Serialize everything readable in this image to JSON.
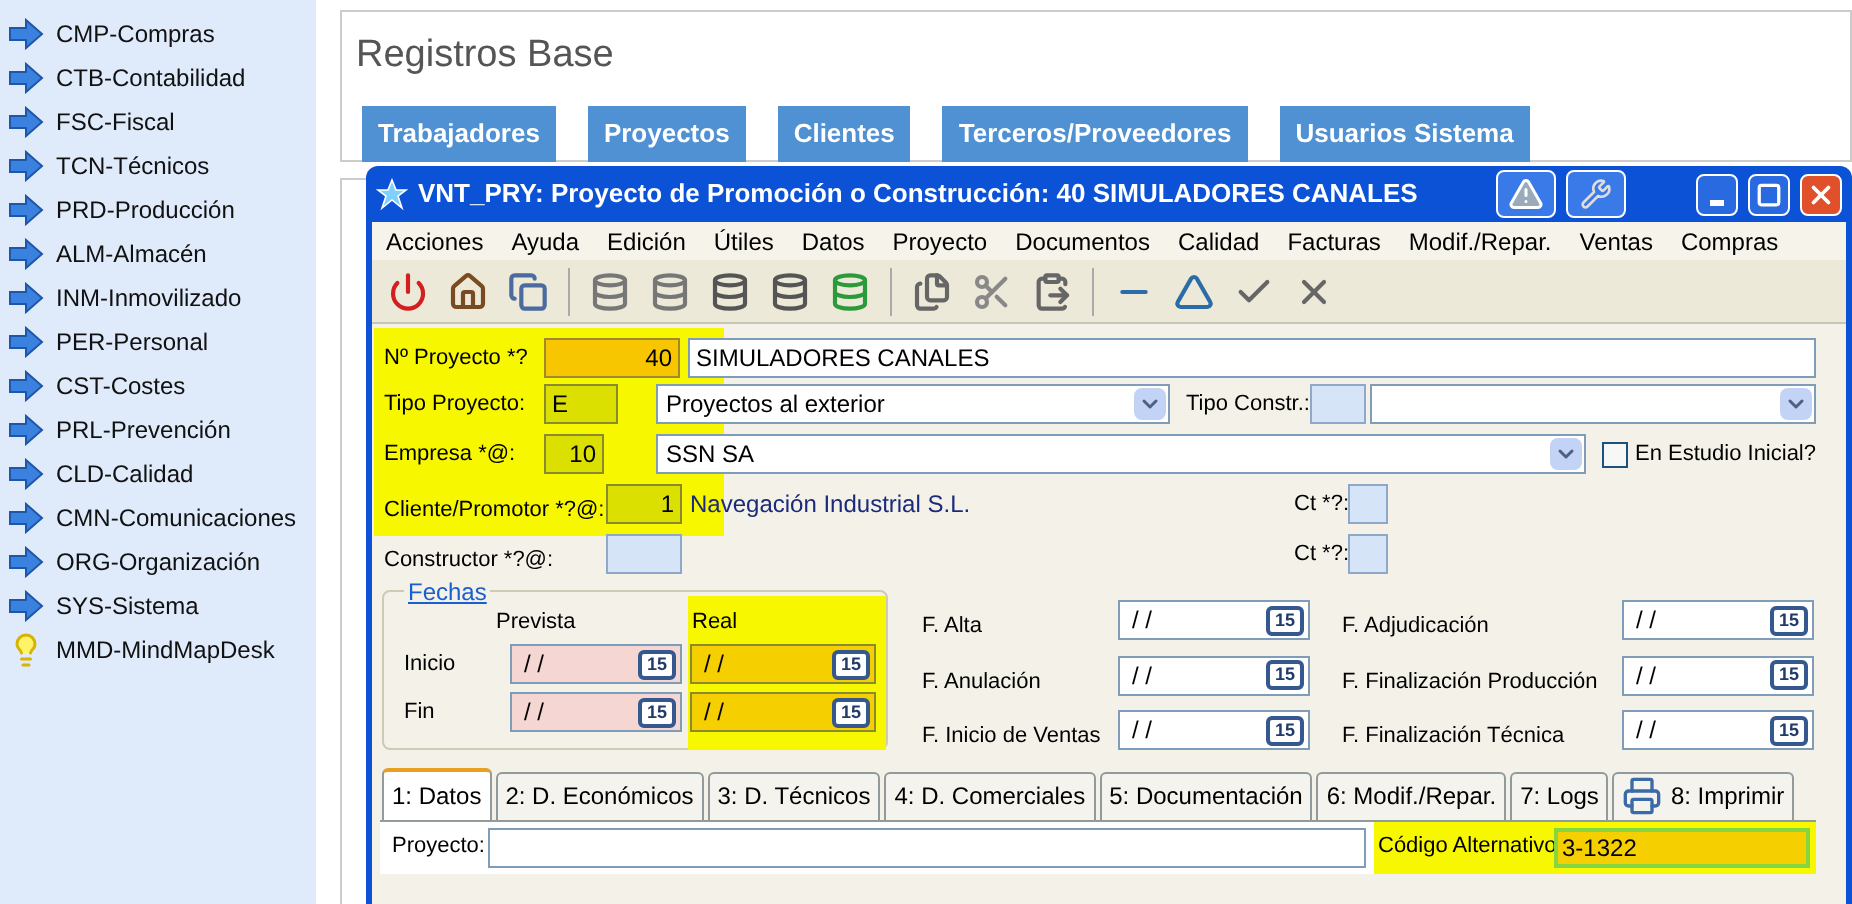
{
  "sidebar": {
    "items": [
      {
        "label": "CMP-Compras",
        "kind": "arrow"
      },
      {
        "label": "CTB-Contabilidad",
        "kind": "arrow"
      },
      {
        "label": "FSC-Fiscal",
        "kind": "arrow"
      },
      {
        "label": "TCN-Técnicos",
        "kind": "arrow"
      },
      {
        "label": "PRD-Producción",
        "kind": "arrow"
      },
      {
        "label": "ALM-Almacén",
        "kind": "arrow"
      },
      {
        "label": "INM-Inmovilizado",
        "kind": "arrow"
      },
      {
        "label": "PER-Personal",
        "kind": "arrow"
      },
      {
        "label": "CST-Costes",
        "kind": "arrow"
      },
      {
        "label": "PRL-Prevención",
        "kind": "arrow"
      },
      {
        "label": "CLD-Calidad",
        "kind": "arrow"
      },
      {
        "label": "CMN-Comunicaciones",
        "kind": "arrow"
      },
      {
        "label": "ORG-Organización",
        "kind": "arrow"
      },
      {
        "label": "SYS-Sistema",
        "kind": "arrow"
      },
      {
        "label": "MMD-MindMapDesk",
        "kind": "bulb"
      }
    ]
  },
  "main": {
    "title": "Registros Base",
    "buttons": [
      "Trabajadores",
      "Proyectos",
      "Clientes",
      "Terceros/Proveedores",
      "Usuarios Sistema"
    ]
  },
  "window": {
    "title": "VNT_PRY: Proyecto de Promoción o Construcción: 40 SIMULADORES CANALES",
    "menu": [
      "Acciones",
      "Ayuda",
      "Edición",
      "Útiles",
      "Datos",
      "Proyecto",
      "Documentos",
      "Calidad",
      "Facturas",
      "Modif./Repar.",
      "Ventas",
      "Compras"
    ],
    "form": {
      "numero": {
        "label": "Nº Proyecto *?",
        "value": "40",
        "kind": "key",
        "name": "SIMULADORES CANALES"
      },
      "tipo": {
        "label": "Tipo Proyecto:",
        "value": "E",
        "kind": "required",
        "select": "Proyectos al exterior"
      },
      "tipo_constr": {
        "label": "Tipo Constr.:"
      },
      "empresa": {
        "label": "Empresa *@:",
        "value": "10",
        "kind": "required",
        "select": "SSN SA"
      },
      "estudio": {
        "label": "En Estudio Inicial?",
        "checked": false
      },
      "cliente": {
        "label": "Cliente/Promotor *?@:",
        "value": "1",
        "kind": "required",
        "name": "Navegación Industrial S.L.",
        "ct_label": "Ct *?:"
      },
      "constructor": {
        "label": "Constructor *?@:",
        "kind": "empty",
        "ct_label": "Ct *?:"
      },
      "fechas": {
        "legend": "Fechas",
        "columns": [
          "Prevista",
          "Real"
        ],
        "rows": [
          {
            "label": "Inicio",
            "dates": [
              {
                "value": "/ /",
                "kind": "planned",
                "icon_text": "15"
              },
              {
                "value": "/ /",
                "kind": "actual",
                "icon_text": "15"
              }
            ]
          },
          {
            "label": "Fin",
            "dates": [
              {
                "value": "/ /",
                "kind": "planned",
                "icon_text": "15"
              },
              {
                "value": "/ /",
                "kind": "actual",
                "icon_text": "15"
              }
            ]
          }
        ]
      },
      "dates_middle": [
        {
          "label": "F. Alta",
          "value": "/ /",
          "icon_text": "15"
        },
        {
          "label": "F. Anulación",
          "value": "/ /",
          "icon_text": "15"
        },
        {
          "label": "F. Inicio de Ventas",
          "value": "/ /",
          "icon_text": "15"
        }
      ],
      "dates_right": [
        {
          "label": "F. Adjudicación",
          "value": "/ /",
          "icon_text": "15"
        },
        {
          "label": "F. Finalización Producción",
          "value": "/ /",
          "icon_text": "15"
        },
        {
          "label": "F. Finalización Técnica",
          "value": "/ /",
          "icon_text": "15"
        }
      ]
    },
    "tabs": [
      {
        "label": "1: Datos",
        "selected": true
      },
      {
        "label": "2: D. Económicos",
        "selected": false
      },
      {
        "label": "3: D. Técnicos",
        "selected": false
      },
      {
        "label": "4: D. Comerciales",
        "selected": false
      },
      {
        "label": "5: Documentación",
        "selected": false
      },
      {
        "label": "6: Modif./Repar.",
        "selected": false
      },
      {
        "label": "7: Logs",
        "selected": false
      },
      {
        "label": "8: Imprimir",
        "selected": false,
        "kind": "print"
      }
    ],
    "proyecto_field": {
      "label": "Proyecto:"
    },
    "codigo": {
      "label": "Código Alternativo",
      "value": "3-1322"
    }
  }
}
